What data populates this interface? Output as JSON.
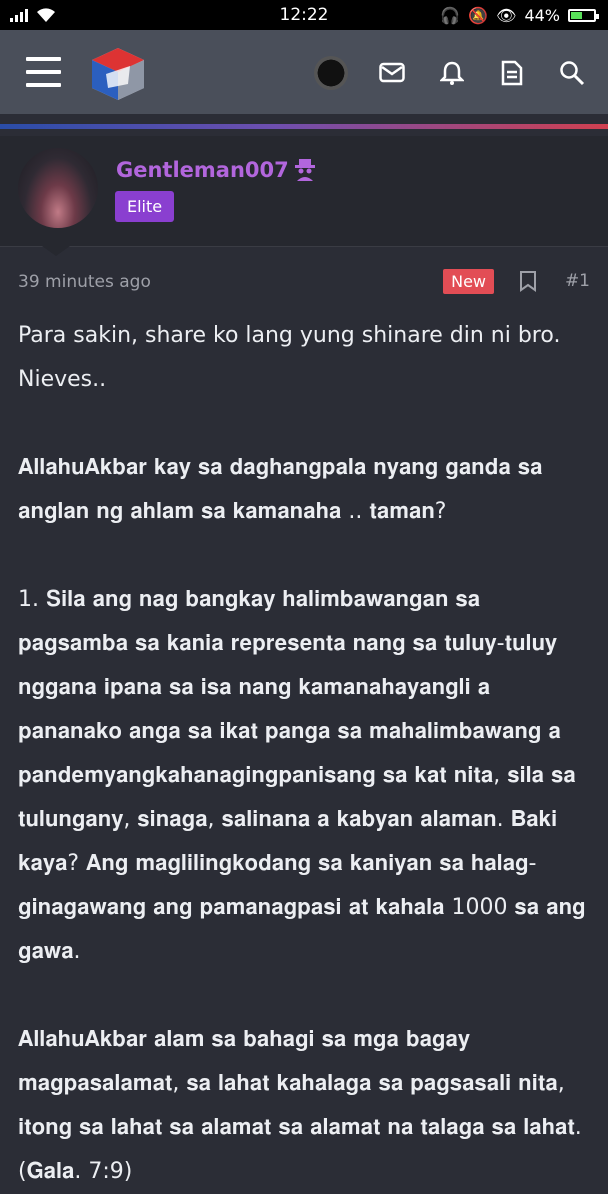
{
  "status_bar": {
    "time": "12:22",
    "battery": "44%",
    "battery_level": 0.44
  },
  "app_bar": {
    "icons": [
      "menu-icon",
      "site-logo",
      "user-avatar",
      "mail-icon",
      "bell-icon",
      "document-icon",
      "search-icon"
    ]
  },
  "post": {
    "username": "Gentleman007",
    "user_badge": "Elite",
    "time_ago": "39 minutes ago",
    "new_label": "New",
    "post_number": "#1",
    "body": [
      "Para sakin, share ko lang yung shinare din ni bro. Nieves..",
      "",
      "𝐀𝐥𝐥𝐚𝐡𝐮𝐀𝐤𝐛𝐚𝐫 𝐤𝐚𝐲 𝐬𝐚 𝐝𝐚𝐠𝐡𝐚𝐧𝐠𝐩𝐚𝐥𝐚 𝐧𝐲𝐚𝐧𝐠 𝐠𝐚𝐧𝐝𝐚 𝐬𝐚 𝐚𝐧𝐠𝐥𝐚𝐧 𝐧𝐠 𝐚𝐡𝐥𝐚𝐦 𝐬𝐚 𝐤𝐚𝐦𝐚𝐧𝐚𝐡𝐚 .. 𝐭𝐚𝐦𝐚𝐧?",
      "",
      "1. 𝐒𝐢𝐥𝐚 𝐚𝐧𝐠 𝐧𝐚𝐠 𝐛𝐚𝐧𝐠𝐤𝐚𝐲 𝐡𝐚𝐥𝐢𝐦𝐛𝐚𝐰𝐚𝐧𝐠𝐚𝐧 𝐬𝐚 𝐩𝐚𝐠𝐬𝐚𝐦𝐛𝐚 𝐬𝐚 𝐤𝐚𝐧𝐢𝐚 𝐫𝐞𝐩𝐫𝐞𝐬𝐞𝐧𝐭𝐚 𝐧𝐚𝐧𝐠 𝐬𝐚 𝐭𝐮𝐥𝐮𝐲-𝐭𝐮𝐥𝐮𝐲 𝐧𝐠𝐠𝐚𝐧𝐚 𝐢𝐩𝐚𝐧𝐚 𝐬𝐚 𝐢𝐬𝐚 𝐧𝐚𝐧𝐠 𝐤𝐚𝐦𝐚𝐧𝐚𝐡𝐚𝐲𝐚𝐧𝐠𝐥𝐢 𝐚 𝐩𝐚𝐧𝐚𝐧𝐚𝐤𝐨 𝐚𝐧𝐠𝐚 𝐬𝐚 𝐢𝐤𝐚𝐭 𝐩𝐚𝐧𝐠𝐚 𝐬𝐚 𝐦𝐚𝐡𝐚𝐥𝐢𝐦𝐛𝐚𝐰𝐚𝐧𝐠 𝐚 𝐩𝐚𝐧𝐝𝐞𝐦𝐲𝐚𝐧𝐠𝐤𝐚𝐡𝐚𝐧𝐚𝐠𝐢𝐧𝐠𝐩𝐚𝐧𝐢𝐬𝐚𝐧𝐠 𝐬𝐚 𝐤𝐚𝐭 𝐧𝐢𝐭𝐚, 𝐬𝐢𝐥𝐚 𝐬𝐚 𝐭𝐮𝐥𝐮𝐧𝐠𝐚𝐧𝐲, 𝐬𝐢𝐧𝐚𝐠𝐚, 𝐬𝐚𝐥𝐢𝐧𝐚𝐧𝐚 𝐚 𝐤𝐚𝐛𝐲𝐚𝐧 𝐚𝐥𝐚𝐦𝐚𝐧. 𝐁𝐚𝐤𝐢 𝐤𝐚𝐲𝐚? 𝐀𝐧𝐠 𝐦𝐚𝐠𝐥𝐢𝐥𝐢𝐧𝐠𝐤𝐨𝐝𝐚𝐧𝐠 𝐬𝐚 𝐤𝐚𝐧𝐢𝐲𝐚𝐧 𝐬𝐚 𝐡𝐚𝐥𝐚𝐠-𝐠𝐢𝐧𝐚𝐠𝐚𝐰𝐚𝐧𝐠 𝐚𝐧𝐠 𝐩𝐚𝐦𝐚𝐧𝐚𝐠𝐩𝐚𝐬𝐢 𝐚𝐭 𝐤𝐚𝐡𝐚𝐥𝐚 1000 𝐬𝐚 𝐚𝐧𝐠 𝐠𝐚𝐰𝐚.",
      "",
      "𝐀𝐥𝐥𝐚𝐡𝐮𝐀𝐤𝐛𝐚𝐫 𝐚𝐥𝐚𝐦 𝐬𝐚 𝐛𝐚𝐡𝐚𝐠𝐢 𝐬𝐚 𝐦𝐠𝐚 𝐛𝐚𝐠𝐚𝐲 𝐦𝐚𝐠𝐩𝐚𝐬𝐚𝐥𝐚𝐦𝐚𝐭, 𝐬𝐚 𝐥𝐚𝐡𝐚𝐭 𝐤𝐚𝐡𝐚𝐥𝐚𝐠𝐚 𝐬𝐚 𝐩𝐚𝐠𝐬𝐚𝐬𝐚𝐥𝐢 𝐧𝐢𝐭𝐚, 𝐢𝐭𝐨𝐧𝐠 𝐬𝐚 𝐥𝐚𝐡𝐚𝐭 𝐬𝐚 𝐚𝐥𝐚𝐦𝐚𝐭 𝐬𝐚 𝐚𝐥𝐚𝐦𝐚𝐭 𝐧𝐚 𝐭𝐚𝐥𝐚𝐠𝐚 𝐬𝐚 𝐥𝐚𝐡𝐚𝐭. (𝐆𝐚𝐥𝐚. 7:9)"
    ]
  }
}
